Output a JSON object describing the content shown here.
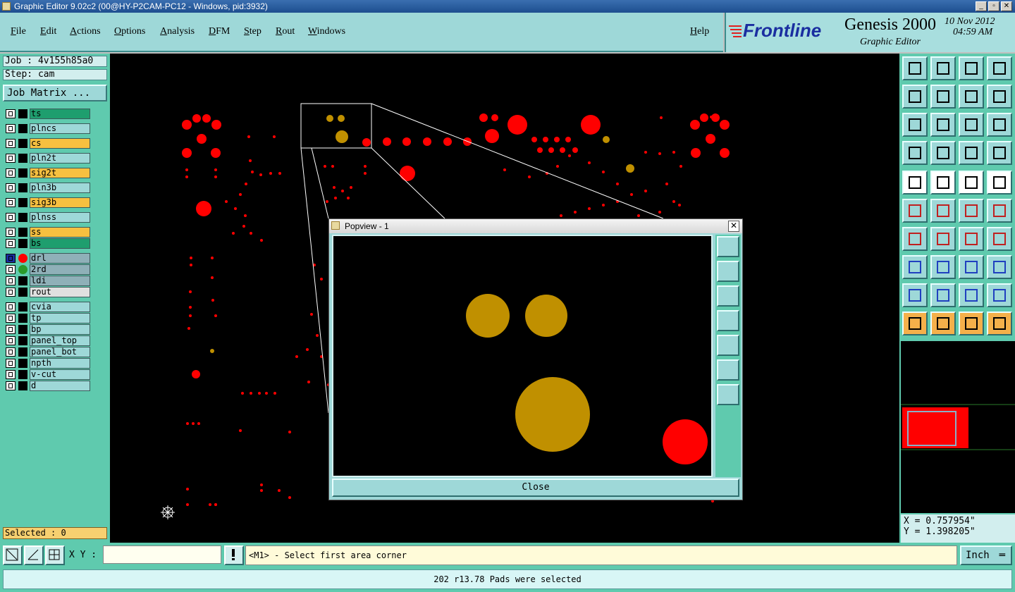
{
  "window": {
    "title": "Graphic Editor 9.02c2 (00@HY-P2CAM-PC12 - Windows, pid:3932)"
  },
  "menu": {
    "file": "File",
    "edit": "Edit",
    "actions": "Actions",
    "options": "Options",
    "analysis": "Analysis",
    "dfm": "DFM",
    "step": "Step",
    "rout": "Rout",
    "windows": "Windows",
    "help": "Help"
  },
  "brand": {
    "logo": "Frontline",
    "product": "Genesis 2000",
    "subtitle": "Graphic Editor",
    "date": "10 Nov 2012",
    "time": "04:59 AM"
  },
  "job": {
    "job_label": "Job : 4v155h85a0",
    "step_label": "Step: cam",
    "matrix_button": "Job Matrix ..."
  },
  "layers": [
    {
      "name": "ts",
      "color": "#1e9e6e"
    },
    {
      "name": "plncs",
      "color": "#9ed8d8"
    },
    {
      "name": "cs",
      "color": "#f7c040"
    },
    {
      "name": "pln2t",
      "color": "#9ed8d8"
    },
    {
      "name": "sig2t",
      "color": "#f7c040"
    },
    {
      "name": "pln3b",
      "color": "#9ed8d8"
    },
    {
      "name": "sig3b",
      "color": "#f7c040"
    },
    {
      "name": "plnss",
      "color": "#9ed8d8"
    },
    {
      "name": "ss",
      "color": "#f7c040"
    },
    {
      "name": "bs",
      "color": "#1e9e6e"
    },
    {
      "name": "drl",
      "color": "#8fb0b8",
      "dot": "#ff0000",
      "active": true
    },
    {
      "name": "2rd",
      "color": "#8fb0b8",
      "dot": "#2a9a2a"
    },
    {
      "name": "ldi",
      "color": "#8fb0b8"
    },
    {
      "name": "rout",
      "color": "#e0e0e0"
    },
    {
      "name": "cvia",
      "color": "#9ed8d8"
    },
    {
      "name": "tp",
      "color": "#9ed8d8"
    },
    {
      "name": "bp",
      "color": "#9ed8d8"
    },
    {
      "name": "panel_top",
      "color": "#9ed8d8"
    },
    {
      "name": "panel_bot",
      "color": "#9ed8d8"
    },
    {
      "name": "npth",
      "color": "#9ed8d8"
    },
    {
      "name": "v-cut",
      "color": "#9ed8d8"
    },
    {
      "name": "d",
      "color": "#9ed8d8"
    }
  ],
  "selection": {
    "label": "Selected : 0"
  },
  "popview": {
    "title": "Popview - 1",
    "close_button": "Close"
  },
  "coords": {
    "x": "X = 0.757954\"",
    "y": "Y = 1.398205\""
  },
  "bottom": {
    "xy_label": "X Y :",
    "xy_value": "",
    "prompt": "<M1> - Select first area corner",
    "units": "Inch",
    "status": "202 r13.78 Pads were selected"
  },
  "colors": {
    "drill": "#ff0000",
    "pad_gold": "#c09000",
    "panel": "#5fcaae",
    "button": "#9ed8d8"
  }
}
